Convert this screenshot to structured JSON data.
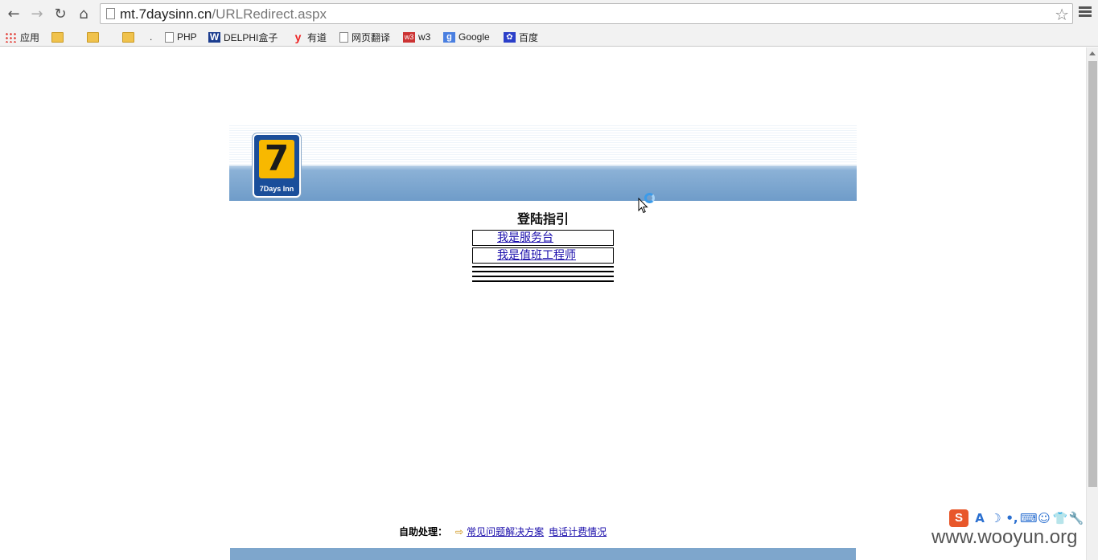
{
  "browser": {
    "url_host": "mt.7daysinn.cn",
    "url_path": "/URLRedirect.aspx"
  },
  "bookmarks": [
    {
      "label": "应用",
      "icon": "apps-grid-icon"
    },
    {
      "label": "",
      "icon": "folder-icon"
    },
    {
      "label": "",
      "icon": "folder-icon"
    },
    {
      "label": "",
      "icon": "folder-icon"
    },
    {
      "label": ".",
      "icon": "none"
    },
    {
      "label": "PHP",
      "icon": "page-icon"
    },
    {
      "label": "DELPHI盒子",
      "icon": "delphi-w-icon"
    },
    {
      "label": "有道",
      "icon": "youdao-icon"
    },
    {
      "label": "网页翻译",
      "icon": "page-icon"
    },
    {
      "label": "w3",
      "icon": "w3-icon"
    },
    {
      "label": "Google",
      "icon": "google-icon"
    },
    {
      "label": "百度",
      "icon": "baidu-paw-icon"
    }
  ],
  "logo": {
    "digit": "7",
    "brand": "7Days Inn"
  },
  "login": {
    "title": "登陆指引",
    "links": [
      "我是服务台",
      "我是值班工程师"
    ]
  },
  "footer": {
    "label": "自助处理：",
    "links": [
      "常见问题解决方案",
      "电话计费情况"
    ]
  },
  "ime_toolbar": {
    "items": [
      "S",
      "A",
      "☽",
      "•,",
      "⌨",
      "☺",
      "👕",
      "🔧"
    ]
  },
  "watermark": "www.wooyun.org"
}
